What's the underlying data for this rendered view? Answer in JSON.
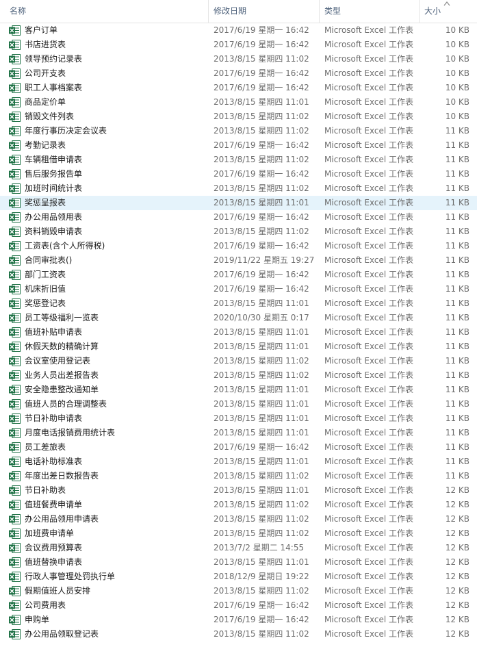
{
  "columns": {
    "name": "名称",
    "date": "修改日期",
    "type": "类型",
    "size": "大小"
  },
  "icon": "excel-file-icon",
  "colors": {
    "excel_green": "#1e7145",
    "selected_row": "#e5f3fb",
    "header_text": "#4c607a"
  },
  "selected_row_index": 12,
  "files": [
    {
      "name": "客户订单",
      "date": "2017/6/19 星期一 16:42",
      "type": "Microsoft Excel 工作表",
      "size": "10 KB"
    },
    {
      "name": "书店进货表",
      "date": "2017/6/19 星期一 16:42",
      "type": "Microsoft Excel 工作表",
      "size": "10 KB"
    },
    {
      "name": "领导预约记录表",
      "date": "2013/8/15 星期四 11:02",
      "type": "Microsoft Excel 工作表",
      "size": "10 KB"
    },
    {
      "name": "公司开支表",
      "date": "2017/6/19 星期一 16:42",
      "type": "Microsoft Excel 工作表",
      "size": "10 KB"
    },
    {
      "name": "职工人事档案表",
      "date": "2017/6/19 星期一 16:42",
      "type": "Microsoft Excel 工作表",
      "size": "10 KB"
    },
    {
      "name": "商品定价单",
      "date": "2013/8/15 星期四 11:01",
      "type": "Microsoft Excel 工作表",
      "size": "10 KB"
    },
    {
      "name": "销毁文件列表",
      "date": "2013/8/15 星期四 11:02",
      "type": "Microsoft Excel 工作表",
      "size": "10 KB"
    },
    {
      "name": "年度行事历决定会议表",
      "date": "2013/8/15 星期四 11:02",
      "type": "Microsoft Excel 工作表",
      "size": "11 KB"
    },
    {
      "name": "考勤记录表",
      "date": "2017/6/19 星期一 16:42",
      "type": "Microsoft Excel 工作表",
      "size": "11 KB"
    },
    {
      "name": "车辆租借申请表",
      "date": "2013/8/15 星期四 11:02",
      "type": "Microsoft Excel 工作表",
      "size": "11 KB"
    },
    {
      "name": "售后服务报告单",
      "date": "2017/6/19 星期一 16:42",
      "type": "Microsoft Excel 工作表",
      "size": "11 KB"
    },
    {
      "name": "加班时间统计表",
      "date": "2013/8/15 星期四 11:02",
      "type": "Microsoft Excel 工作表",
      "size": "11 KB"
    },
    {
      "name": "奖惩呈报表",
      "date": "2013/8/15 星期四 11:01",
      "type": "Microsoft Excel 工作表",
      "size": "11 KB"
    },
    {
      "name": "办公用品领用表",
      "date": "2017/6/19 星期一 16:42",
      "type": "Microsoft Excel 工作表",
      "size": "11 KB"
    },
    {
      "name": "资料销毁申请表",
      "date": "2013/8/15 星期四 11:02",
      "type": "Microsoft Excel 工作表",
      "size": "11 KB"
    },
    {
      "name": "工资表(含个人所得税)",
      "date": "2017/6/19 星期一 16:42",
      "type": "Microsoft Excel 工作表",
      "size": "11 KB"
    },
    {
      "name": "合同审批表()",
      "date": "2019/11/22 星期五 19:27",
      "type": "Microsoft Excel 工作表",
      "size": "11 KB"
    },
    {
      "name": "部门工资表",
      "date": "2017/6/19 星期一 16:42",
      "type": "Microsoft Excel 工作表",
      "size": "11 KB"
    },
    {
      "name": "机床折旧值",
      "date": "2017/6/19 星期一 16:42",
      "type": "Microsoft Excel 工作表",
      "size": "11 KB"
    },
    {
      "name": "奖惩登记表",
      "date": "2013/8/15 星期四 11:01",
      "type": "Microsoft Excel 工作表",
      "size": "11 KB"
    },
    {
      "name": "员工等级福利一览表",
      "date": "2020/10/30 星期五 0:17",
      "type": "Microsoft Excel 工作表",
      "size": "11 KB"
    },
    {
      "name": "值班补贴申请表",
      "date": "2013/8/15 星期四 11:01",
      "type": "Microsoft Excel 工作表",
      "size": "11 KB"
    },
    {
      "name": "休假天数的精确计算",
      "date": "2013/8/15 星期四 11:01",
      "type": "Microsoft Excel 工作表",
      "size": "11 KB"
    },
    {
      "name": "会议室使用登记表",
      "date": "2013/8/15 星期四 11:02",
      "type": "Microsoft Excel 工作表",
      "size": "11 KB"
    },
    {
      "name": "业务人员出差报告表",
      "date": "2013/8/15 星期四 11:02",
      "type": "Microsoft Excel 工作表",
      "size": "11 KB"
    },
    {
      "name": "安全隐患整改通知单",
      "date": "2013/8/15 星期四 11:01",
      "type": "Microsoft Excel 工作表",
      "size": "11 KB"
    },
    {
      "name": "值班人员的合理调整表",
      "date": "2013/8/15 星期四 11:01",
      "type": "Microsoft Excel 工作表",
      "size": "11 KB"
    },
    {
      "name": "节日补助申请表",
      "date": "2013/8/15 星期四 11:01",
      "type": "Microsoft Excel 工作表",
      "size": "11 KB"
    },
    {
      "name": "月度电话报销费用统计表",
      "date": "2013/8/15 星期四 11:01",
      "type": "Microsoft Excel 工作表",
      "size": "11 KB"
    },
    {
      "name": "员工差旅表",
      "date": "2017/6/19 星期一 16:42",
      "type": "Microsoft Excel 工作表",
      "size": "11 KB"
    },
    {
      "name": "电话补助标准表",
      "date": "2013/8/15 星期四 11:01",
      "type": "Microsoft Excel 工作表",
      "size": "11 KB"
    },
    {
      "name": "年度出差日数报告表",
      "date": "2013/8/15 星期四 11:02",
      "type": "Microsoft Excel 工作表",
      "size": "11 KB"
    },
    {
      "name": "节日补助表",
      "date": "2013/8/15 星期四 11:01",
      "type": "Microsoft Excel 工作表",
      "size": "12 KB"
    },
    {
      "name": "值班餐费申请单",
      "date": "2013/8/15 星期四 11:02",
      "type": "Microsoft Excel 工作表",
      "size": "12 KB"
    },
    {
      "name": "办公用品领用申请表",
      "date": "2013/8/15 星期四 11:02",
      "type": "Microsoft Excel 工作表",
      "size": "12 KB"
    },
    {
      "name": "加班费申请单",
      "date": "2013/8/15 星期四 11:02",
      "type": "Microsoft Excel 工作表",
      "size": "12 KB"
    },
    {
      "name": "会议费用预算表",
      "date": "2013/7/2 星期二 14:55",
      "type": "Microsoft Excel 工作表",
      "size": "12 KB"
    },
    {
      "name": "值班替换申请表",
      "date": "2013/8/15 星期四 11:01",
      "type": "Microsoft Excel 工作表",
      "size": "12 KB"
    },
    {
      "name": "行政人事管理处罚执行单",
      "date": "2018/12/9 星期日 19:22",
      "type": "Microsoft Excel 工作表",
      "size": "12 KB"
    },
    {
      "name": "假期值班人员安排",
      "date": "2013/8/15 星期四 11:02",
      "type": "Microsoft Excel 工作表",
      "size": "12 KB"
    },
    {
      "name": "公司费用表",
      "date": "2017/6/19 星期一 16:42",
      "type": "Microsoft Excel 工作表",
      "size": "12 KB"
    },
    {
      "name": "申购单",
      "date": "2017/6/19 星期一 16:42",
      "type": "Microsoft Excel 工作表",
      "size": "12 KB"
    },
    {
      "name": "办公用品领取登记表",
      "date": "2013/8/15 星期四 11:02",
      "type": "Microsoft Excel 工作表",
      "size": "12 KB"
    }
  ]
}
